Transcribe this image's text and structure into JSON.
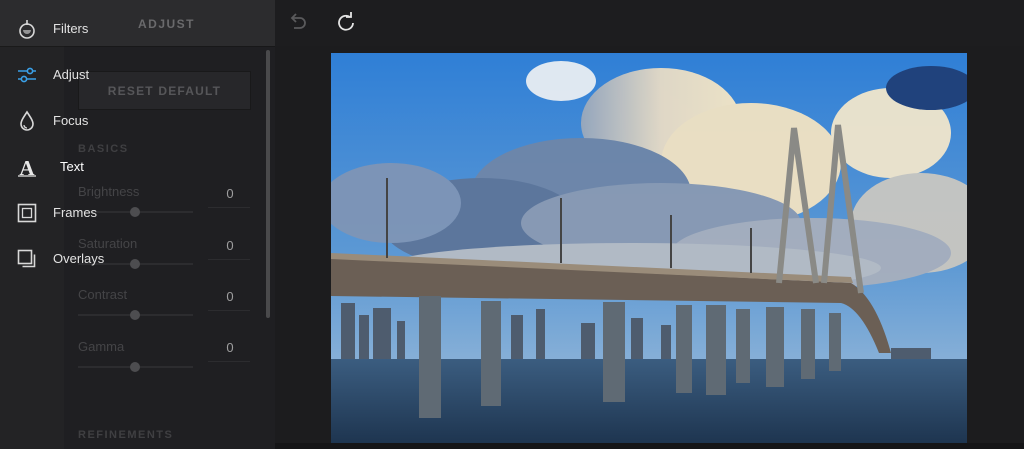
{
  "panel": {
    "title": "ADJUST",
    "reset_label": "RESET DEFAULT",
    "sections": {
      "basics": "BASICS",
      "refinements": "REFINEMENTS"
    },
    "sliders": [
      {
        "label": "Brightness",
        "value": "0"
      },
      {
        "label": "Saturation",
        "value": "0"
      },
      {
        "label": "Contrast",
        "value": "0"
      },
      {
        "label": "Gamma",
        "value": "0"
      }
    ]
  },
  "tools": [
    {
      "label": "Filters",
      "icon": "filters-icon"
    },
    {
      "label": "Adjust",
      "icon": "adjust-icon",
      "active": true
    },
    {
      "label": "Focus",
      "icon": "focus-icon"
    },
    {
      "label": "Text",
      "icon": "text-icon"
    },
    {
      "label": "Frames",
      "icon": "frames-icon"
    },
    {
      "label": "Overlays",
      "icon": "overlays-icon"
    }
  ],
  "toolbar": {
    "undo_icon": "undo-icon",
    "redo_icon": "redo-icon"
  },
  "colors": {
    "accent": "#3aa0e8",
    "rail": "#232325",
    "canvas_bg": "#1c1c1e"
  }
}
